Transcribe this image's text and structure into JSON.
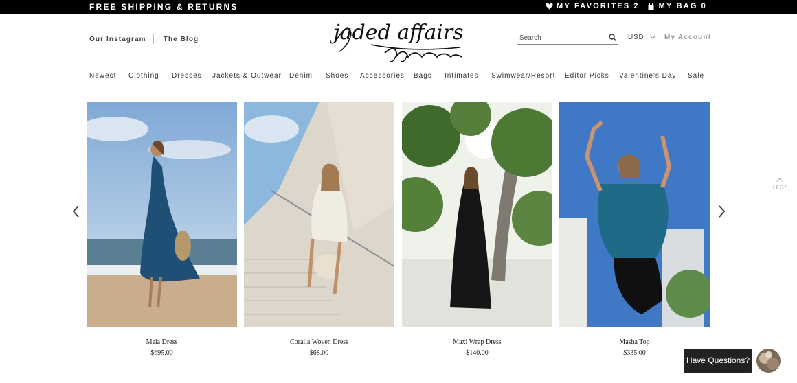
{
  "topbar": {
    "promo": "FREE SHIPPING & RETURNS",
    "favorites_label": "MY FAVORITES",
    "favorites_count": "2",
    "bag_label": "MY BAG",
    "bag_count": "0"
  },
  "header": {
    "links": [
      "Our Instagram",
      "The Blog"
    ],
    "logo_text": "jaded affairs",
    "search_placeholder": "Search",
    "currency": "USD",
    "account": "My Account"
  },
  "nav": {
    "items": [
      "Newest",
      "Clothing",
      "Dresses",
      "Jackets & Outwear",
      "Denim",
      "Shoes",
      "Accessories",
      "Bags",
      "Intimates",
      "Swimwear/Resort",
      "Editor Picks",
      "Valentine's Day",
      "Sale"
    ]
  },
  "products": [
    {
      "name": "Mela Dress",
      "price": "$695.00"
    },
    {
      "name": "Coralia Woven Dress",
      "price": "$68.00"
    },
    {
      "name": "Maxi Wrap Dress",
      "price": "$140.00"
    },
    {
      "name": "Masha Top",
      "price": "$335.00"
    }
  ],
  "back_to_top": "TOP",
  "chat": {
    "label": "Have Questions?"
  },
  "colors": {
    "topbar": "#000000",
    "account_link": "#9a9a9a",
    "chat_button": "#222222"
  },
  "icons": {
    "favorites": "heart-icon",
    "bag": "bag-icon",
    "search": "search-icon",
    "prev": "chevron-left-icon",
    "next": "chevron-right-icon"
  }
}
